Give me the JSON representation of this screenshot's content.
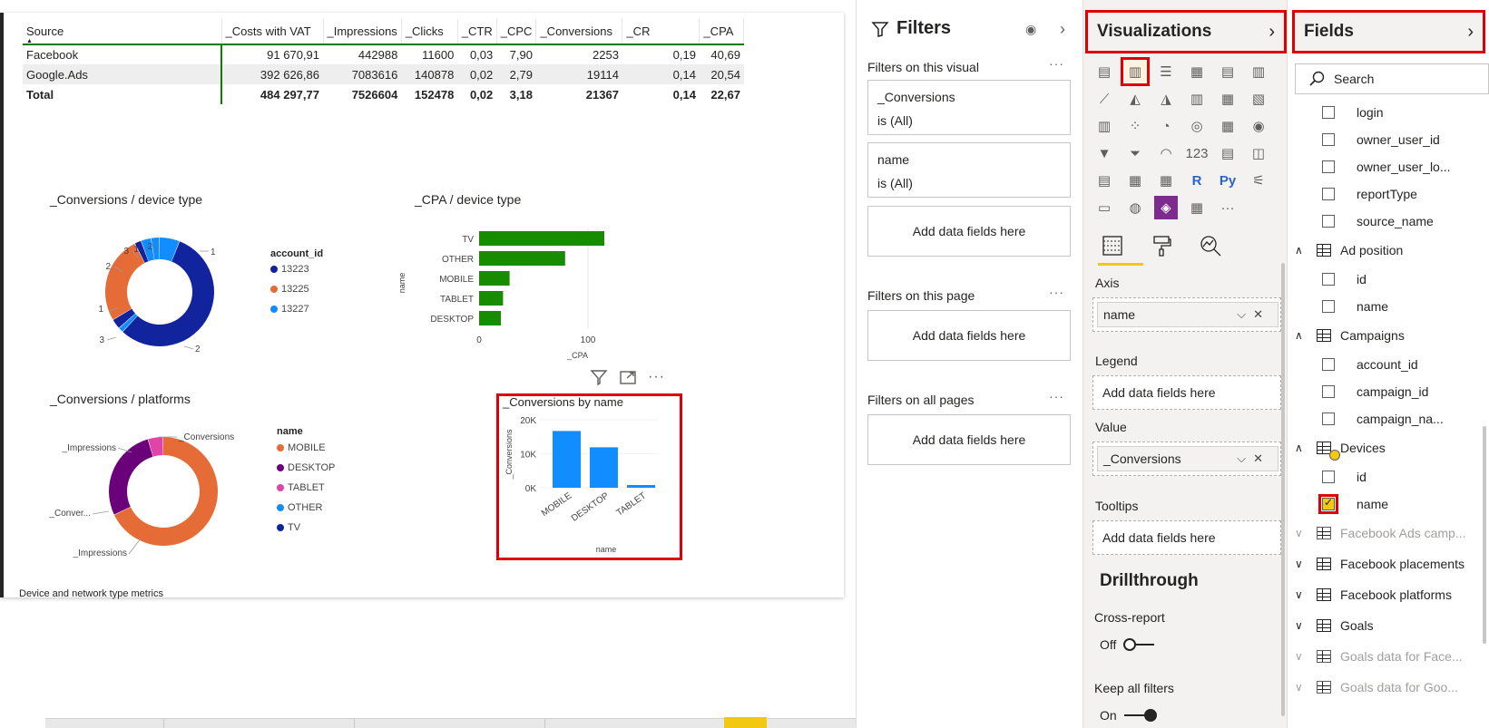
{
  "table": {
    "headers": [
      "Source",
      "_Costs with VAT",
      "_Impressions",
      "_Clicks",
      "_CTR",
      "_CPC",
      "_Conversions",
      "_CR",
      "_CPA"
    ],
    "rows": [
      [
        "Facebook",
        "91 670,91",
        "442988",
        "11600",
        "0,03",
        "7,90",
        "2253",
        "0,19",
        "40,69"
      ],
      [
        "Google.Ads",
        "392 626,86",
        "7083616",
        "140878",
        "0,02",
        "2,79",
        "19114",
        "0,14",
        "20,54"
      ],
      [
        "Total",
        "484 297,77",
        "7526604",
        "152478",
        "0,02",
        "3,18",
        "21367",
        "0,14",
        "22,67"
      ]
    ]
  },
  "donut_device": {
    "title": "_Conversions / device type",
    "legend_title": "account_id",
    "legend": [
      {
        "label": "13223",
        "color": "#12239e"
      },
      {
        "label": "13225",
        "color": "#e66c37"
      },
      {
        "label": "13227",
        "color": "#118dff"
      }
    ],
    "slice_labels": [
      "1",
      "2",
      "3",
      "1",
      "2",
      "3",
      "1",
      "2"
    ]
  },
  "donut_platforms": {
    "title": "_Conversions / platforms",
    "legend_title": "name",
    "legend": [
      {
        "label": "MOBILE",
        "color": "#e66c37"
      },
      {
        "label": "DESKTOP",
        "color": "#6b007b"
      },
      {
        "label": "TABLET",
        "color": "#e044a7"
      },
      {
        "label": "OTHER",
        "color": "#118dff"
      },
      {
        "label": "TV",
        "color": "#12239e"
      }
    ],
    "slice_labels": [
      "_Conversions",
      "_Impressions",
      "_Conver...",
      "_Impressions"
    ]
  },
  "cpa_title": "_CPA / device type",
  "conv_title": "_Conversions by name",
  "footer_text": "Device and network type metrics",
  "chart_data": [
    {
      "type": "bar",
      "title": "_CPA / device type",
      "orientation": "horizontal",
      "xlabel": "_CPA",
      "ylabel": "name",
      "categories": [
        "TV",
        "OTHER",
        "MOBILE",
        "TABLET",
        "DESKTOP"
      ],
      "values": [
        115,
        79,
        28,
        22,
        20
      ],
      "xticks": [
        "0",
        "100"
      ],
      "xlim": [
        0,
        135
      ],
      "color": "#178c00"
    },
    {
      "type": "bar",
      "title": "_Conversions by name",
      "xlabel": "name",
      "ylabel": "_Conversions",
      "categories": [
        "MOBILE",
        "DESKTOP",
        "TABLET"
      ],
      "values": [
        16700,
        11900,
        800
      ],
      "yticks": [
        "0K",
        "10K",
        "20K"
      ],
      "ylim": [
        0,
        20000
      ],
      "color": "#118dff"
    }
  ],
  "filters": {
    "title": "Filters",
    "on_visual": "Filters on this visual",
    "cards": [
      {
        "field": "_Conversions",
        "state": "is (All)"
      },
      {
        "field": "name",
        "state": "is (All)"
      }
    ],
    "add_label": "Add data fields here",
    "on_page": "Filters on this page",
    "on_all": "Filters on all pages"
  },
  "viz": {
    "title": "Visualizations",
    "icons": [
      "▤",
      "▥",
      "☰",
      "▦",
      "▤",
      "▥",
      "⟋",
      "◭",
      "◮",
      "▥",
      "▦",
      "▧",
      "▥",
      "⁘",
      "◔",
      "◎",
      "▦",
      "◉",
      "▼",
      "⏷",
      "◠",
      "123",
      "▤",
      "◫",
      "▤",
      "▦",
      "▦",
      "R",
      "Py",
      "⚟",
      "▭",
      "◍",
      "◈",
      "▦",
      "···"
    ],
    "axis_label": "Axis",
    "axis_field": "name",
    "legend_label": "Legend",
    "value_label": "Value",
    "value_field": "_Conversions",
    "tooltips_label": "Tooltips",
    "add_label": "Add data fields here",
    "drill_heading": "Drillthrough",
    "cross_report_label": "Cross-report",
    "cross_report_state": "Off",
    "keep_filters_label": "Keep all filters",
    "keep_filters_state": "On"
  },
  "fields": {
    "title": "Fields",
    "search_placeholder": "Search",
    "items": [
      {
        "kind": "field",
        "label": "login"
      },
      {
        "kind": "field",
        "label": "owner_user_id"
      },
      {
        "kind": "field",
        "label": "owner_user_lo..."
      },
      {
        "kind": "field",
        "label": "reportType"
      },
      {
        "kind": "field",
        "label": "source_name"
      },
      {
        "kind": "table",
        "label": "Ad position",
        "expanded": true
      },
      {
        "kind": "field",
        "label": "id"
      },
      {
        "kind": "field",
        "label": "name"
      },
      {
        "kind": "table",
        "label": "Campaigns",
        "expanded": true
      },
      {
        "kind": "field",
        "label": "account_id"
      },
      {
        "kind": "field",
        "label": "campaign_id"
      },
      {
        "kind": "field",
        "label": "campaign_na..."
      },
      {
        "kind": "table",
        "label": "Devices",
        "expanded": true
      },
      {
        "kind": "field",
        "label": "id"
      },
      {
        "kind": "field",
        "label": "name",
        "checked": true
      },
      {
        "kind": "table",
        "label": "Facebook Ads camp...",
        "dim": true
      },
      {
        "kind": "table",
        "label": "Facebook placements"
      },
      {
        "kind": "table",
        "label": "Facebook platforms"
      },
      {
        "kind": "table",
        "label": "Goals"
      },
      {
        "kind": "table",
        "label": "Goals data for Face...",
        "dim": true
      },
      {
        "kind": "table",
        "label": "Goals data for Goo...",
        "dim": true
      }
    ]
  }
}
